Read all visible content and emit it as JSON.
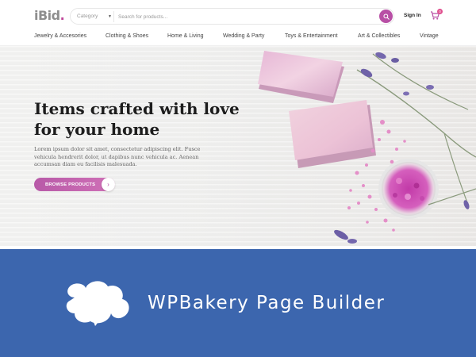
{
  "header": {
    "logo_text": "iBid",
    "logo_dot": ".",
    "search": {
      "category_label": "Category",
      "placeholder": "Search for products..."
    },
    "signin_label": "Sign In",
    "cart_count": "0"
  },
  "nav": {
    "items": [
      "Jewelry & Accesories",
      "Clothing & Shoes",
      "Home & Living",
      "Wedding & Party",
      "Toys & Entertainment",
      "Art & Collectibles",
      "Vintage"
    ]
  },
  "hero": {
    "title": "Items crafted with love\nfor your home",
    "description": "Lorem ipsum dolor sit amet, consectetur adipiscing elit. Fusce vehicula hendrerit dolor, ut dapibus nunc vehicula ac. Aenean accumsan diam eu facilisis malesuada.",
    "button_label": "BROWSE PRODUCTS"
  },
  "banner": {
    "text": "WPBakery Page Builder"
  },
  "colors": {
    "accent": "#b84fa5",
    "banner_bg": "#3c66ae",
    "cart_badge": "#e0508f"
  },
  "icons": {
    "search": "search-icon",
    "cart": "cart-icon",
    "arrow": "arrow-right-icon",
    "category_chevron": "chevron-down-icon",
    "banner_logo": "wpbakery-logo-icon"
  }
}
